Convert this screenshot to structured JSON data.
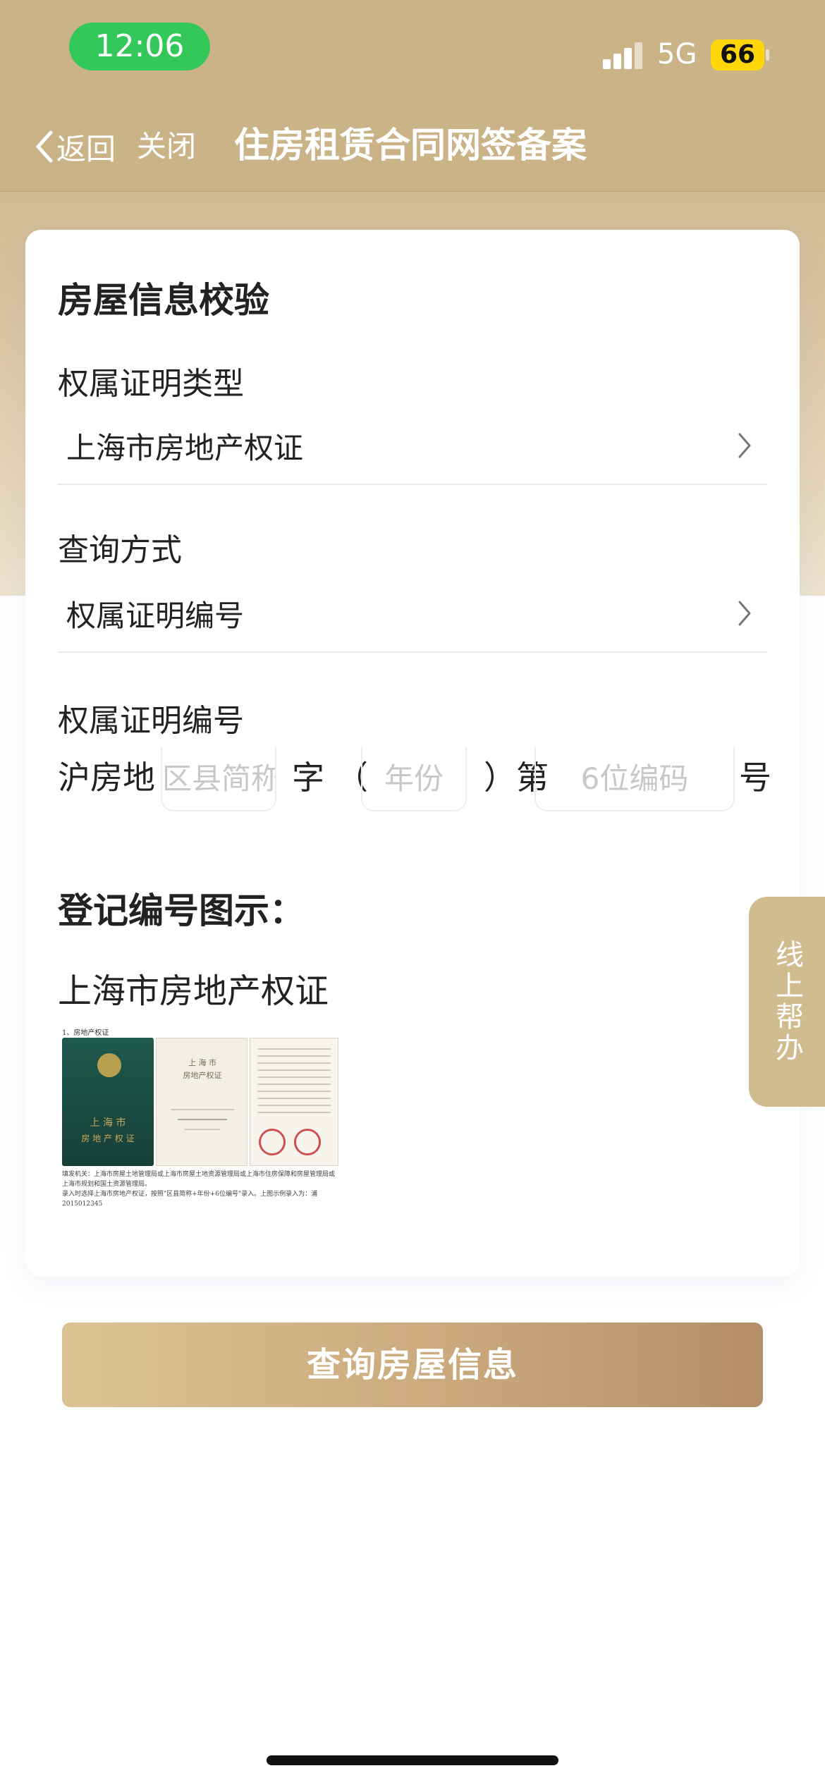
{
  "status_bar": {
    "time": "12:06",
    "network": "5G",
    "battery": "66"
  },
  "nav": {
    "back_label": "返回",
    "close_label": "关闭",
    "title": "住房租赁合同网签备案"
  },
  "card": {
    "title": "房屋信息校验",
    "fields": [
      {
        "label": "权属证明类型",
        "value": "上海市房地产权证"
      },
      {
        "label": "查询方式",
        "value": "权属证明编号"
      }
    ],
    "cert_number": {
      "label": "权属证明编号",
      "prefix": "沪房地",
      "district_placeholder": "区县简称",
      "char_zi": "字",
      "open_paren": "（",
      "year_placeholder": "年份",
      "close_paren": "）第",
      "code_placeholder": "6位编码",
      "suffix": "号"
    },
    "example_heading": "登记编号图示：",
    "example_title": "上海市房地产权证",
    "sample": {
      "heading": "1、房地产权证",
      "cover_city": "上 海 市",
      "cover_title": "房 地 产 权 证",
      "page_city": "上 海 市",
      "page_title": "房地产权证",
      "note_line1": "填发机关：上海市房屋土地管理局或上海市房屋土地资源管理局或上海市住房保障和房屋管理局或上海市规划和国土资源管理局。",
      "note_line2": "录入时选择上海市房地产权证，按照\"区县简称+年份+6位编号\"录入。上图示例录入为：浦 2015012345"
    }
  },
  "side_help": {
    "label": "线上帮办"
  },
  "action": {
    "query_label": "查询房屋信息"
  }
}
